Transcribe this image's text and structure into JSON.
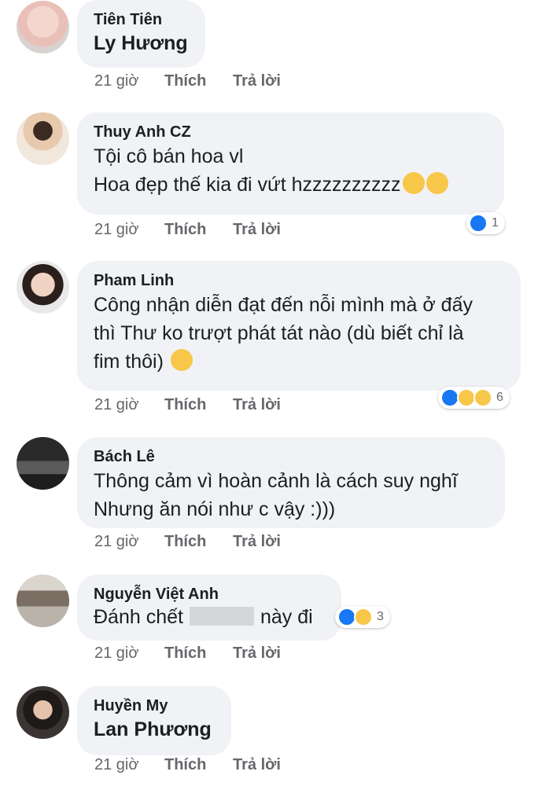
{
  "comments": [
    {
      "author": "Tiên Tiên",
      "lines": [
        "Ly Hương"
      ],
      "time": "21 giờ",
      "like": "Thích",
      "reply": "Trả lời"
    },
    {
      "author": "Thuy Anh CZ",
      "lines": [
        "Tội cô bán hoa vl",
        "Hoa đẹp thế kia đi vứt hzzzzzzzzzz"
      ],
      "time": "21 giờ",
      "like": "Thích",
      "reply": "Trả lời",
      "reaction_count": "1"
    },
    {
      "author": "Pham Linh",
      "lines": [
        "Công nhận diễn đạt đến nỗi mình mà ở đấy",
        "thì Thư ko trượt phát tát nào (dù biết chỉ là",
        "fim thôi)"
      ],
      "time": "21 giờ",
      "like": "Thích",
      "reply": "Trả lời",
      "reaction_count": "6"
    },
    {
      "author": "Bách Lê",
      "lines": [
        "Thông cảm vì hoàn cảnh là cách suy nghĩ",
        "Nhưng ăn nói như c vậy :)))"
      ],
      "time": "21 giờ",
      "like": "Thích",
      "reply": "Trả lời"
    },
    {
      "author": "Nguyễn Việt Anh",
      "lines": [
        "Đánh chết",
        "này đi"
      ],
      "time": "21 giờ",
      "like": "Thích",
      "reply": "Trả lời",
      "reaction_count": "3"
    },
    {
      "author": "Huyền My",
      "lines": [
        "Lan Phương"
      ],
      "time": "21 giờ",
      "like": "Thích",
      "reply": "Trả lời"
    }
  ],
  "colors": {
    "bubble": "#f0f2f5",
    "meta": "#65676b",
    "like_blue": "#1877f2",
    "emoji_yellow": "#f7c74a"
  }
}
